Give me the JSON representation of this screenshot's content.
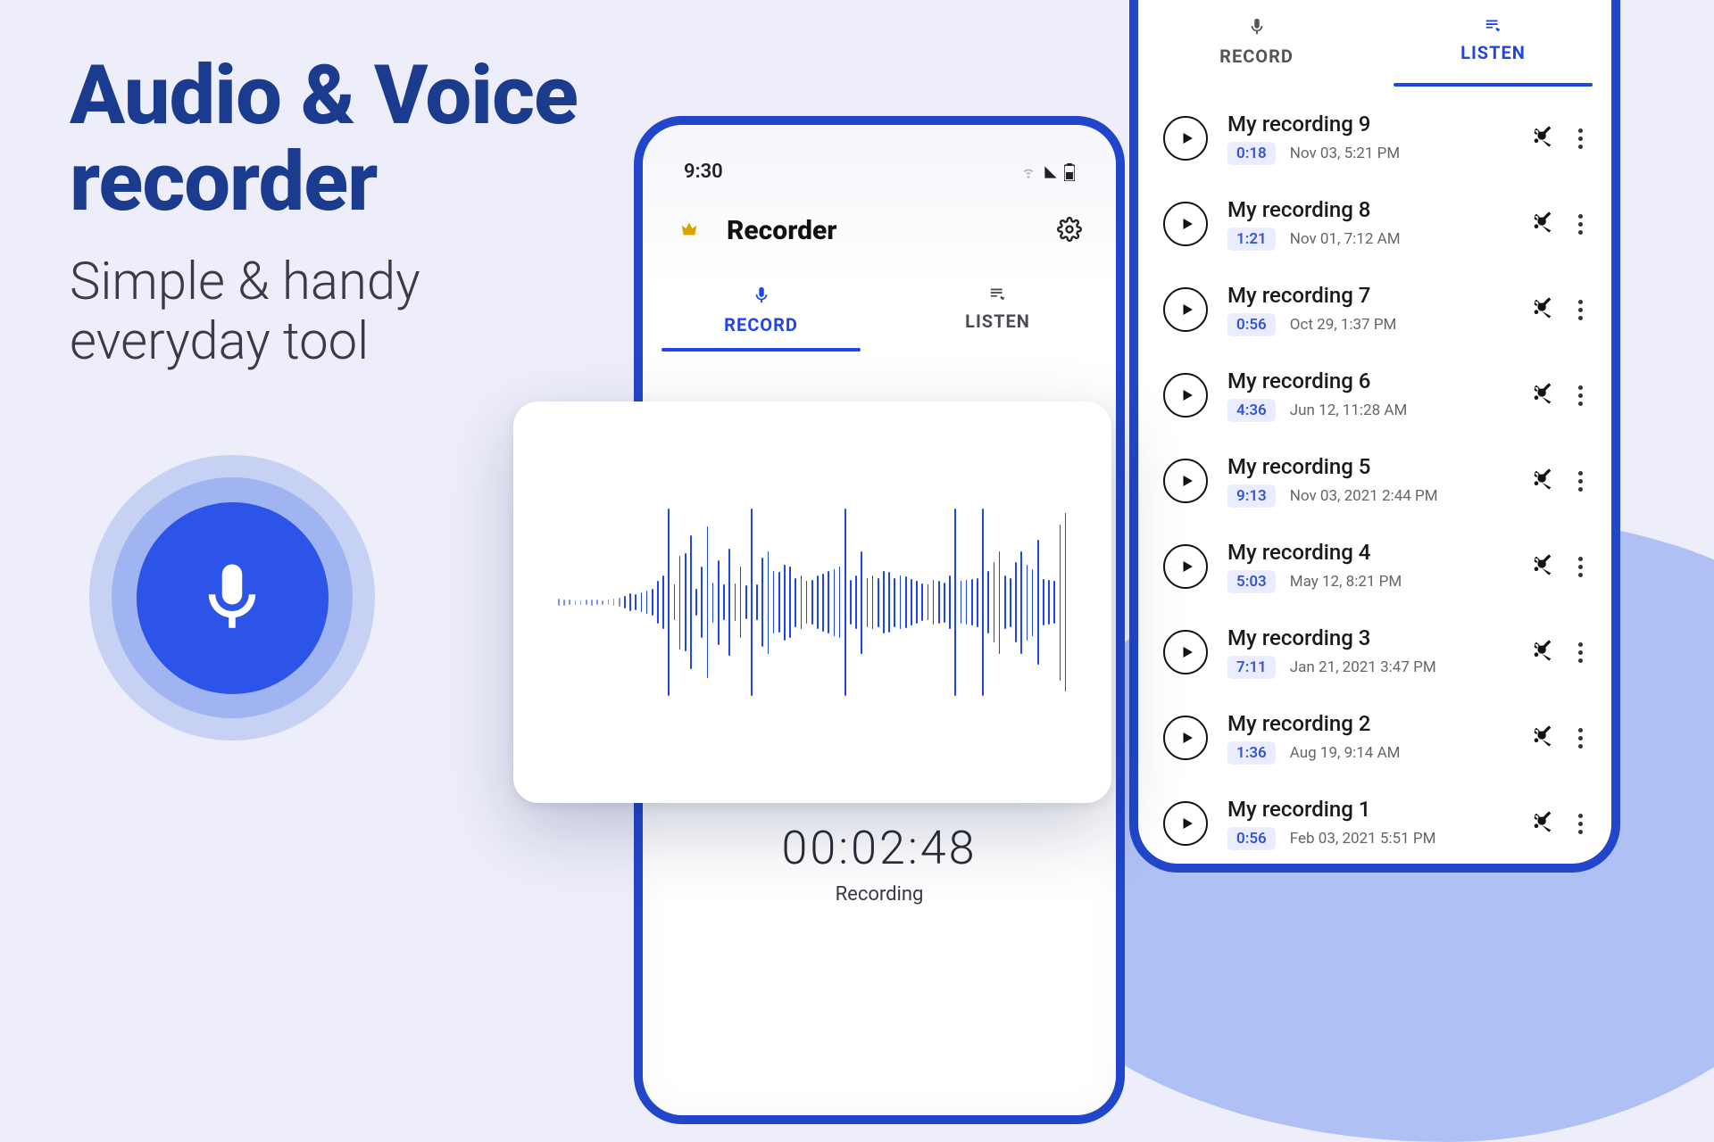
{
  "hero": {
    "title_line1": "Audio & Voice",
    "title_line2": "recorder",
    "subtitle_line1": "Simple & handy",
    "subtitle_line2": "everyday tool"
  },
  "phoneA": {
    "statusbar_time": "9:30",
    "app_title": "Recorder",
    "tab_record": "RECORD",
    "tab_listen": "LISTEN",
    "timer": "00:02:48",
    "recording_status": "Recording"
  },
  "phoneB": {
    "tab_record": "RECORD",
    "tab_listen": "LISTEN",
    "recordings": [
      {
        "title": "My recording 9",
        "duration": "0:18",
        "date": "Nov 03, 5:21 PM"
      },
      {
        "title": "My recording 8",
        "duration": "1:21",
        "date": "Nov 01, 7:12 AM"
      },
      {
        "title": "My recording 7",
        "duration": "0:56",
        "date": "Oct 29, 1:37 PM"
      },
      {
        "title": "My recording 6",
        "duration": "4:36",
        "date": "Jun 12, 11:28 AM"
      },
      {
        "title": "My recording 5",
        "duration": "9:13",
        "date": "Nov 03, 2021 2:44 PM"
      },
      {
        "title": "My recording 4",
        "duration": "5:03",
        "date": "May 12, 8:21 PM"
      },
      {
        "title": "My recording 3",
        "duration": "7:11",
        "date": "Jan 21, 2021 3:47 PM"
      },
      {
        "title": "My recording 2",
        "duration": "1:36",
        "date": "Aug 19, 9:14 AM"
      },
      {
        "title": "My recording 1",
        "duration": "0:56",
        "date": "Feb 03, 2021 5:51 PM"
      }
    ]
  },
  "waveform_heights": [
    8,
    7,
    6,
    5,
    5,
    6,
    7,
    6,
    5,
    6,
    8,
    10,
    14,
    20,
    18,
    22,
    26,
    30,
    48,
    60,
    210,
    40,
    105,
    110,
    150,
    30,
    80,
    170,
    45,
    95,
    40,
    120,
    42,
    80,
    38,
    210,
    40,
    100,
    115,
    70,
    68,
    85,
    80,
    55,
    60,
    48,
    50,
    60,
    65,
    70,
    75,
    80,
    210,
    50,
    60,
    115,
    55,
    60,
    55,
    70,
    68,
    55,
    60,
    58,
    52,
    48,
    42,
    40,
    50,
    48,
    45,
    60,
    210,
    48,
    50,
    52,
    55,
    210,
    70,
    90,
    115,
    60,
    55,
    90,
    115,
    85,
    75,
    140,
    52,
    50,
    48,
    175,
    200
  ]
}
